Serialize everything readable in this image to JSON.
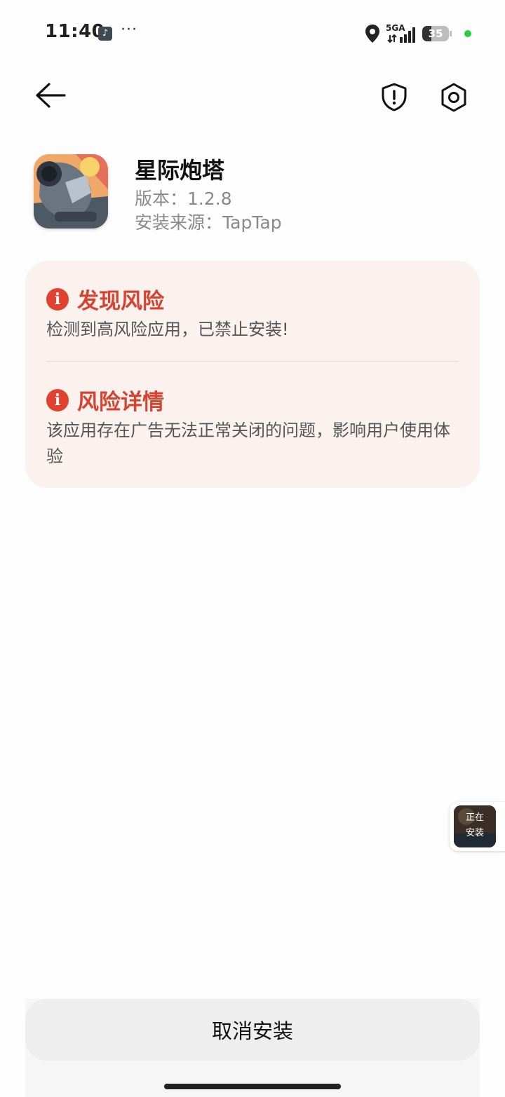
{
  "status_bar": {
    "time": "11:40",
    "more": "···",
    "network": "5GA",
    "battery": "35"
  },
  "app": {
    "name": "星际炮塔",
    "version": "版本：1.2.8",
    "source": "安装来源：TapTap"
  },
  "risk": {
    "found_title": "发现风险",
    "found_text": "检测到高风险应用，已禁止安装!",
    "detail_title": "风险详情",
    "detail_text": "该应用存在广告无法正常关闭的问题，影响用户使用体验"
  },
  "floating": {
    "label_line1": "正在",
    "label_line2": "安装"
  },
  "actions": {
    "cancel_label": "取消安装"
  },
  "colors": {
    "risk_red": "#d8432f",
    "card_bg": "#fbf1ef",
    "button_bg": "#eeeeee"
  },
  "icons": [
    "tiktok-icon",
    "more-icon",
    "location-icon",
    "signal-icon",
    "battery-icon",
    "back-arrow-icon",
    "shield-alert-icon",
    "settings-gear-icon",
    "info-icon"
  ]
}
